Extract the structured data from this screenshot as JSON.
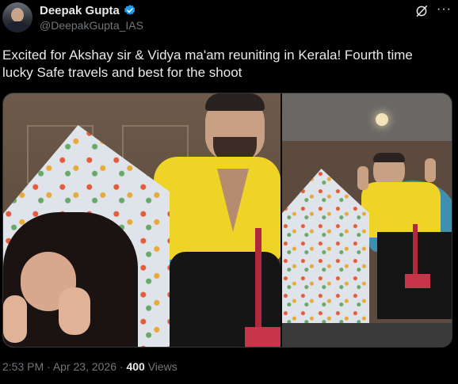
{
  "author": {
    "name": "Deepak Gupta",
    "handle": "@DeepakGupta_IAS"
  },
  "tweet": {
    "text": "Excited for Akshay sir & Vidya ma'am reuniting in Kerala! Fourth time lucky  Safe travels and best for the shoot"
  },
  "meta": {
    "time": "2:53 PM",
    "separator": "·",
    "date": "Apr 23, 2026",
    "views_count": "400",
    "views_label": "Views"
  },
  "icons": {
    "verified": "verified-badge-icon",
    "grok": "grok-icon",
    "more": "more-options-icon"
  },
  "colors": {
    "background": "#000000",
    "text": "#e7e9ea",
    "muted": "#71767b",
    "verified": "#1d9bf0"
  }
}
